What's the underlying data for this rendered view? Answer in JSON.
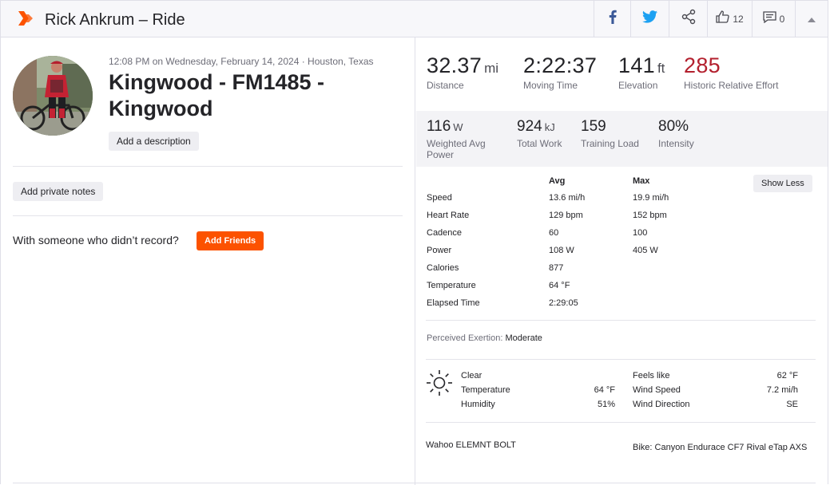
{
  "header": {
    "title": "Rick Ankrum – Ride",
    "kudos_count": "12",
    "comment_count": "0"
  },
  "activity": {
    "meta": "12:08 PM on Wednesday, February 14, 2024 · Houston, Texas",
    "title": "Kingwood - FM1485 - Kingwood",
    "add_description": "Add a description",
    "add_private_notes": "Add private notes",
    "with_someone": "With someone who didn’t record?",
    "add_friends": "Add Friends"
  },
  "primary_stats": [
    {
      "value": "32.37",
      "unit": "mi",
      "label": "Distance"
    },
    {
      "value": "2:22:37",
      "unit": "",
      "label": "Moving Time"
    },
    {
      "value": "141",
      "unit": "ft",
      "label": "Elevation"
    },
    {
      "value": "285",
      "unit": "",
      "label": "Historic Relative Effort"
    }
  ],
  "secondary_stats": [
    {
      "value": "116",
      "unit": "W",
      "label": "Weighted Avg Power"
    },
    {
      "value": "924",
      "unit": "kJ",
      "label": "Total Work"
    },
    {
      "value": "159",
      "unit": "",
      "label": "Training Load"
    },
    {
      "value": "80%",
      "unit": "",
      "label": "Intensity"
    }
  ],
  "table": {
    "avg_header": "Avg",
    "max_header": "Max",
    "show_less": "Show Less",
    "rows": [
      {
        "name": "Speed",
        "avg": "13.6 mi/h",
        "max": "19.9 mi/h"
      },
      {
        "name": "Heart Rate",
        "avg": "129 bpm",
        "max": "152 bpm"
      },
      {
        "name": "Cadence",
        "avg": "60",
        "max": "100"
      },
      {
        "name": "Power",
        "avg": "108 W",
        "max": "405 W"
      },
      {
        "name": "Calories",
        "avg": "877",
        "max": ""
      },
      {
        "name": "Temperature",
        "avg": "64 °F",
        "max": ""
      },
      {
        "name": "Elapsed Time",
        "avg": "2:29:05",
        "max": ""
      }
    ]
  },
  "perceived_exertion": {
    "label": "Perceived Exertion:",
    "value": "Moderate"
  },
  "weather": {
    "condition": "Clear",
    "temperature_label": "Temperature",
    "temperature_value": "64 °F",
    "humidity_label": "Humidity",
    "humidity_value": "51%",
    "feels_like_label": "Feels like",
    "feels_like_value": "62 °F",
    "wind_speed_label": "Wind Speed",
    "wind_speed_value": "7.2 mi/h",
    "wind_direction_label": "Wind Direction",
    "wind_direction_value": "SE"
  },
  "device": "Wahoo ELEMNT BOLT",
  "bike": "Bike: Canyon Endurace CF7 Rival eTap AXS",
  "colors": {
    "brand_orange": "#fc5200",
    "relative_effort_red": "#b3202e",
    "facebook_blue": "#3b5998",
    "twitter_blue": "#1da1f2"
  },
  "icons": [
    "strava-logo-icon",
    "facebook-icon",
    "twitter-icon",
    "share-icon",
    "thumbs-up-icon",
    "comment-icon",
    "chevron-up-icon",
    "sun-icon"
  ]
}
